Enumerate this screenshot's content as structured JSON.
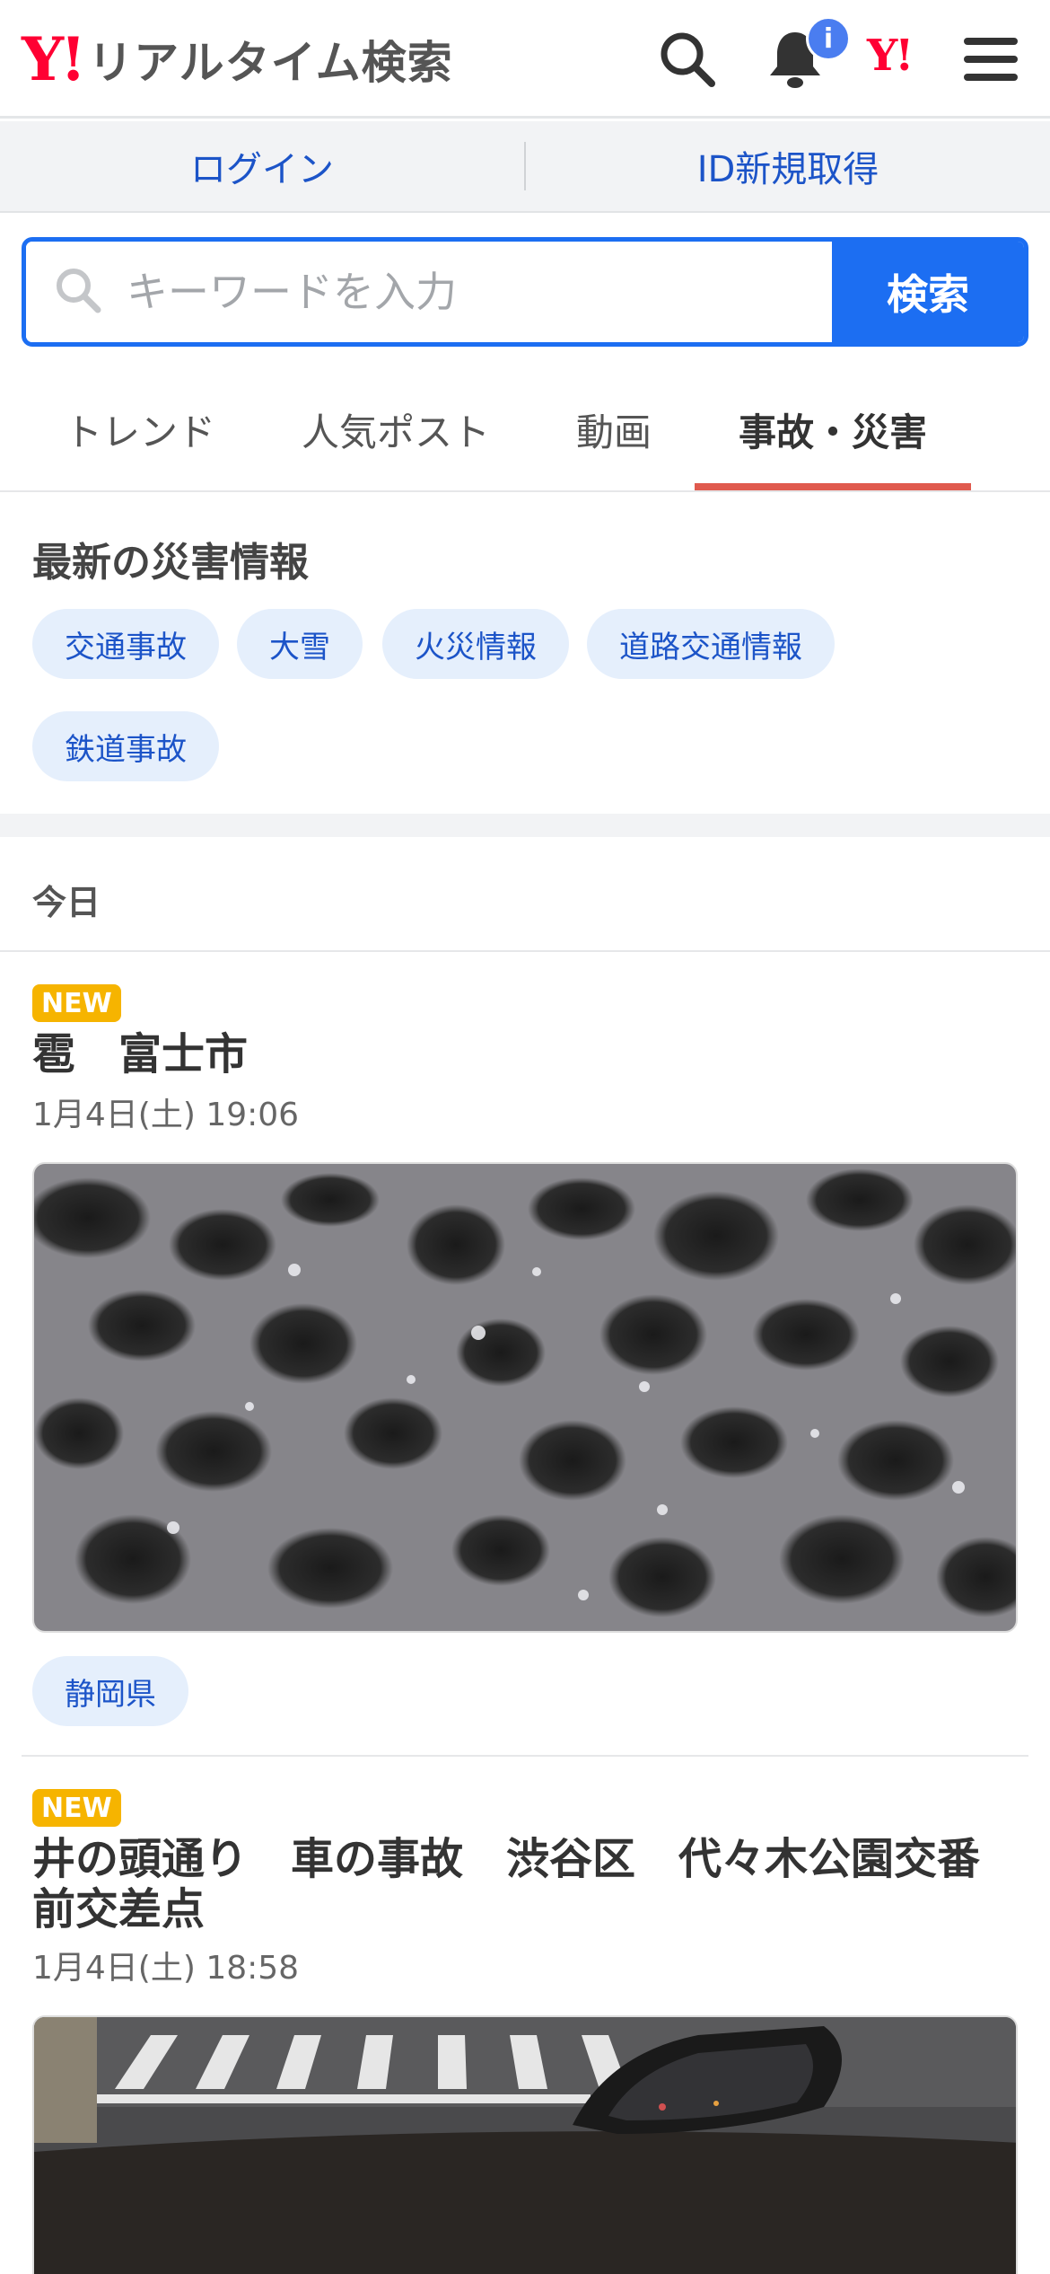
{
  "header": {
    "logo_mark": "Y!",
    "logo_text": "リアルタイム検索",
    "notification_count": "i",
    "yahoo_mark": "Y!"
  },
  "account": {
    "login": "ログイン",
    "register": "ID新規取得"
  },
  "search": {
    "placeholder": "キーワードを入力",
    "button": "検索"
  },
  "tabs": [
    {
      "label": "トレンド"
    },
    {
      "label": "人気ポスト"
    },
    {
      "label": "動画"
    },
    {
      "label": "事故・災害",
      "active": true
    }
  ],
  "disaster": {
    "heading": "最新の災害情報",
    "chips": [
      "交通事故",
      "大雪",
      "火災情報",
      "道路交通情報",
      "鉄道事故"
    ]
  },
  "section": {
    "date_header": "今日"
  },
  "posts": [
    {
      "badge": "NEW",
      "title": "雹　富士市",
      "date": "1月4日(土) 19:06",
      "image": "hail-on-asphalt-night",
      "tag": "静岡県"
    },
    {
      "badge": "NEW",
      "title": "井の頭通り　車の事故　渋谷区　代々木公園交番前交差点",
      "date": "1月4日(土) 18:58",
      "image": "crosswalk-from-car-night"
    }
  ],
  "colors": {
    "brand_red": "#ff0033",
    "link_blue": "#1c54c8",
    "search_blue": "#1c6ef2",
    "tab_underline": "#e05a4e",
    "new_badge": "#f6b400",
    "chip_bg": "#e5effc"
  }
}
